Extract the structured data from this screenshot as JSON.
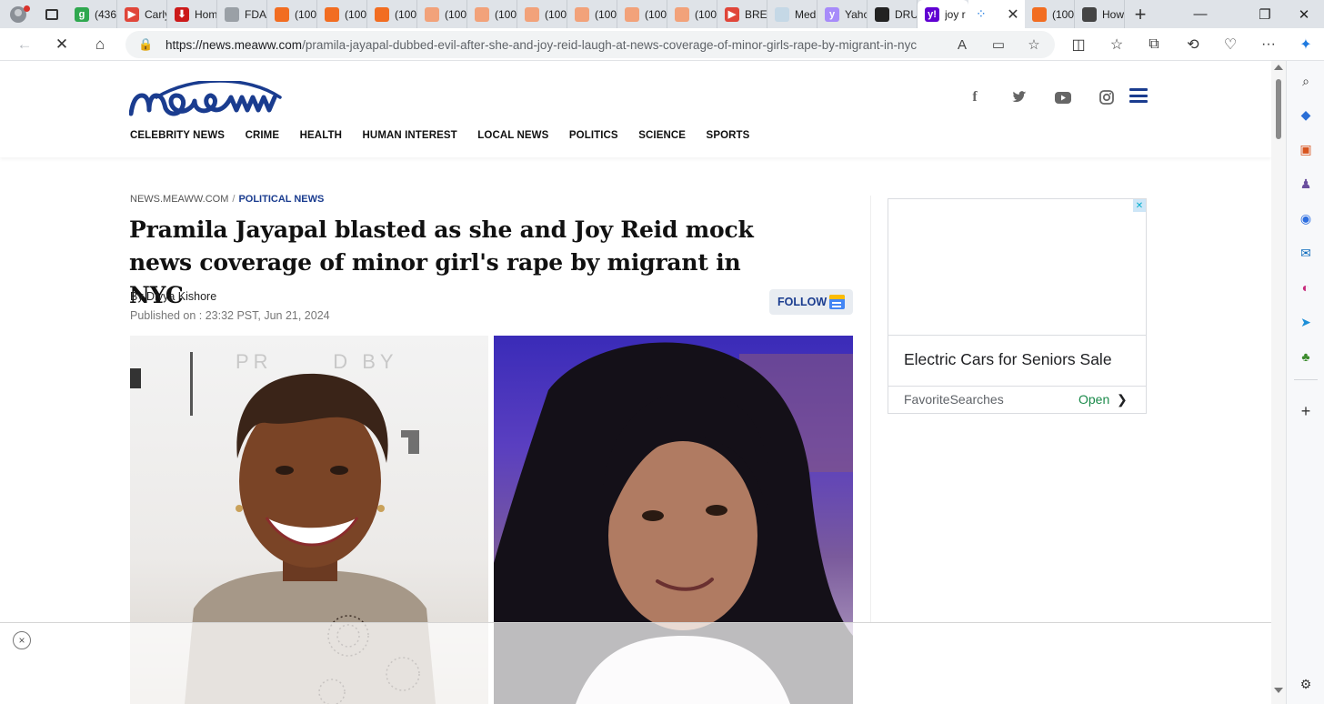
{
  "browser": {
    "tabs": [
      {
        "label": "(436",
        "favicon": "g",
        "color": "#2fa84f"
      },
      {
        "label": "Carly",
        "favicon": "▶",
        "color": "#e0463a"
      },
      {
        "label": "Hom",
        "favicon": "⬇",
        "color": "#cc1a1a"
      },
      {
        "label": "FDA",
        "favicon": "",
        "color": "#9aa0a6"
      },
      {
        "label": "(100",
        "favicon": "",
        "color": "#f26d21"
      },
      {
        "label": "(100",
        "favicon": "",
        "color": "#f26d21"
      },
      {
        "label": "(100",
        "favicon": "",
        "color": "#f26d21"
      },
      {
        "label": "(100",
        "favicon": "",
        "color": "#f2a27a"
      },
      {
        "label": "(100",
        "favicon": "",
        "color": "#f2a27a"
      },
      {
        "label": "(100",
        "favicon": "",
        "color": "#f2a27a"
      },
      {
        "label": "(100",
        "favicon": "",
        "color": "#f2a27a"
      },
      {
        "label": "(100",
        "favicon": "",
        "color": "#f2a27a"
      },
      {
        "label": "(100",
        "favicon": "",
        "color": "#f2a27a"
      },
      {
        "label": "BRE/",
        "favicon": "▶",
        "color": "#e0463a"
      },
      {
        "label": "Med",
        "favicon": "",
        "color": "#c5d8e6"
      },
      {
        "label": "Yahc",
        "favicon": "y",
        "color": "#a78bfa"
      },
      {
        "label": "DRU",
        "favicon": "",
        "color": "#222222"
      },
      {
        "label": "joy r",
        "favicon": "y!",
        "color": "#6001d2"
      },
      {
        "label": "(100",
        "favicon": "",
        "color": "#f26d21"
      },
      {
        "label": "How",
        "favicon": "",
        "color": "#444444"
      }
    ],
    "url_host": "https://news.meaww.com",
    "url_path": "/pramila-jayapal-dubbed-evil-after-she-and-joy-reid-laugh-at-news-coverage-of-minor-girls-rape-by-migrant-in-nyc"
  },
  "site": {
    "nav": [
      "CELEBRITY NEWS",
      "CRIME",
      "HEALTH",
      "HUMAN INTEREST",
      "LOCAL NEWS",
      "POLITICS",
      "SCIENCE",
      "SPORTS"
    ],
    "social": {
      "facebook": "f"
    }
  },
  "article": {
    "breadcrumb_home": "NEWS.MEAWW.COM",
    "breadcrumb_sep": "/",
    "breadcrumb_category": "POLITICAL NEWS",
    "headline": "Pramila Jayapal blasted as she and Joy Reid mock news coverage of minor girl's rape by migrant in NYC",
    "byline": "By Divya Kishore",
    "published": "Published on : 23:32 PST, Jun 21, 2024",
    "follow_label": "FOLLOW",
    "photo_left_watermark": "PR      D BY"
  },
  "ad": {
    "title": "Electric Cars for Seniors Sale",
    "source": "FavoriteSearches",
    "cta": "Open",
    "close": "✕"
  },
  "sticky": {
    "close": "×"
  }
}
